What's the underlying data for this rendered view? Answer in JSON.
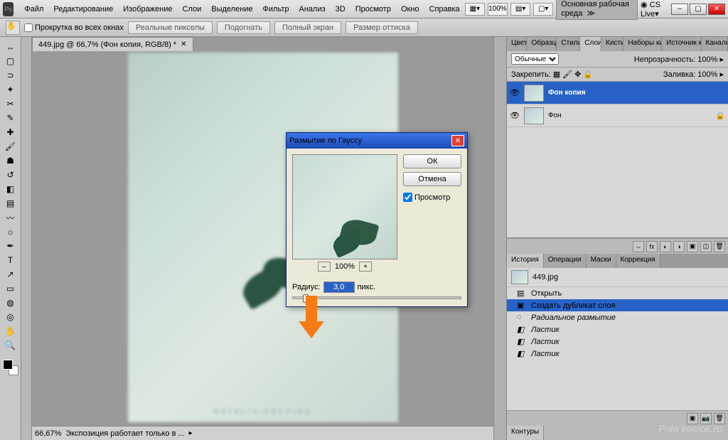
{
  "menubar": {
    "items": [
      "Файл",
      "Редактирование",
      "Изображение",
      "Слои",
      "Выделение",
      "Фильтр",
      "Анализ",
      "3D",
      "Просмотр",
      "Окно",
      "Справка"
    ],
    "zoom": "100%",
    "workspace": "Основная рабочая среда",
    "cslive": "CS Live"
  },
  "optionsbar": {
    "scroll_all": "Прокрутка во всех окнах",
    "buttons": [
      "Реальные пикселы",
      "Подогнать",
      "Полный экран",
      "Размер оттиска"
    ]
  },
  "document": {
    "tab_title": "449.jpg @ 66,7% (Фон копия, RGB/8) *",
    "zoom": "66,67%",
    "status": "Экспозиция работает только в ..."
  },
  "dialog": {
    "title": "Размытие по Гауссу",
    "ok": "ОК",
    "cancel": "Отмена",
    "preview_label": "Просмотр",
    "zoom_pct": "100%",
    "radius_label": "Радиус:",
    "radius_value": "3,0",
    "unit": "пикс."
  },
  "panels": {
    "top_tabs": [
      "Цвет",
      "Образцы",
      "Стили",
      "Слои",
      "Кисти",
      "Наборы кист",
      "Источник кло",
      "Каналы"
    ],
    "top_active": "Слои",
    "layers": {
      "blend_mode": "Обычные",
      "opacity_label": "Непрозрачность:",
      "opacity_value": "100%",
      "lock_label": "Закрепить:",
      "fill_label": "Заливка:",
      "fill_value": "100%",
      "rows": [
        {
          "name": "Фон копия",
          "active": true,
          "locked": false
        },
        {
          "name": "Фон",
          "active": false,
          "locked": true
        }
      ]
    },
    "mid_tabs": [
      "История",
      "Операции",
      "Маски",
      "Коррекция"
    ],
    "mid_active": "История",
    "history": {
      "doc": "449.jpg",
      "entries": [
        {
          "label": "Открыть",
          "dim": false,
          "active": false
        },
        {
          "label": "Создать дубликат слоя",
          "dim": false,
          "active": true
        },
        {
          "label": "Радиальное размытие",
          "dim": true,
          "active": false
        },
        {
          "label": "Ластик",
          "dim": true,
          "active": false
        },
        {
          "label": "Ластик",
          "dim": true,
          "active": false
        },
        {
          "label": "Ластик",
          "dim": true,
          "active": false
        }
      ]
    },
    "bottom_tabs": [
      "Контуры"
    ]
  },
  "watermark": "Foto komok.ru",
  "canvas_caption": "NATALIA DREPINA"
}
